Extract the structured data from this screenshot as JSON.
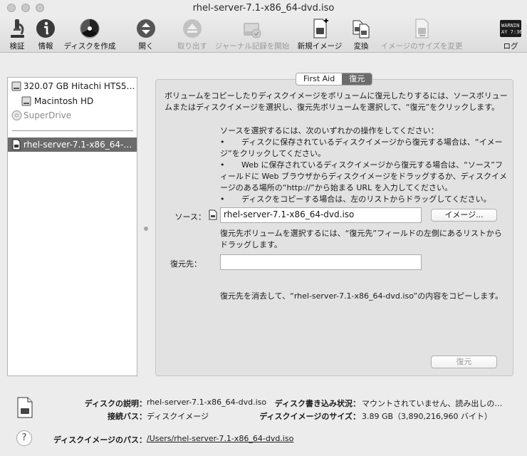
{
  "window": {
    "title": "rhel-server-7.1-x86_64-dvd.iso"
  },
  "toolbar": {
    "verify": "検証",
    "info": "情報",
    "burn": "ディスクを作成",
    "open": "開く",
    "eject": "取り出す",
    "journal": "ジャーナル記録を開始",
    "new_image": "新規イメージ",
    "convert": "変換",
    "resize": "イメージのサイズを変更",
    "log": "ログ",
    "log_icon_text_1": "WARNIN",
    "log_icon_text_2": "AY 7:36"
  },
  "sidebar": {
    "items": [
      {
        "label": "320.07 GB Hitachi HTS5…",
        "icon": "hard-disk-icon"
      },
      {
        "label": "Macintosh HD",
        "icon": "volume-icon"
      },
      {
        "label": "SuperDrive",
        "icon": "optical-drive-icon"
      },
      {
        "label": "rhel-server-7.1-x86_64-…",
        "icon": "disk-image-icon"
      }
    ]
  },
  "tabs": {
    "first_aid": "First Aid",
    "restore": "復元"
  },
  "restore": {
    "intro": "ボリュームをコピーしたりディスクイメージをボリュームに復元したりするには、ソースボリュームまたはディスクイメージを選択し、復元先ボリュームを選択して、“復元”をクリックします。",
    "source_help_title": "ソースを選択するには、次のいずれかの操作をしてください：",
    "bullet_1": "ディスクに保存されているディスクイメージから復元する場合は、“イメージ”をクリックしてください。",
    "bullet_2": "Web に保存されているディスクイメージから復元する場合は、“ソース”フィールドに Web ブラウザからディスクイメージをドラッグするか、ディスクイメージのある場所の“http://”から始まる URL を入力してください。",
    "bullet_3": "ディスクをコピーする場合は、左のリストからドラッグしてください。",
    "bullet_symbol": "•",
    "source_label": "ソース：",
    "source_value": "rhel-server-7.1-x86_64-dvd.iso",
    "image_button": "イメージ...",
    "destination_help": "復元先ボリュームを選択するには、“復元先”フィールドの左側にあるリストからドラッグします。",
    "destination_label": "復元先：",
    "destination_value": "",
    "erase_note": "復元先を消去して、“rhel-server-7.1-x86_64-dvd.iso”の内容をコピーします。",
    "restore_button": "復元"
  },
  "info": {
    "description_label": "ディスクの説明：",
    "description_value": "rhel-server-7.1-x86_64-dvd.iso",
    "connection_label": "接続バス：",
    "connection_value": "ディスクイメージ",
    "write_status_label": "ディスク書き込み状況：",
    "write_status_value": "マウントされていません、読み出しの…",
    "image_size_label": "ディスクイメージのサイズ：",
    "image_size_value": "3.89 GB（3,890,216,960 バイト）",
    "path_label": "ディスクイメージのパス：",
    "path_value": "/Users/rhel-server-7.1-x86_64-dvd.iso"
  },
  "help": {
    "symbol": "?"
  }
}
